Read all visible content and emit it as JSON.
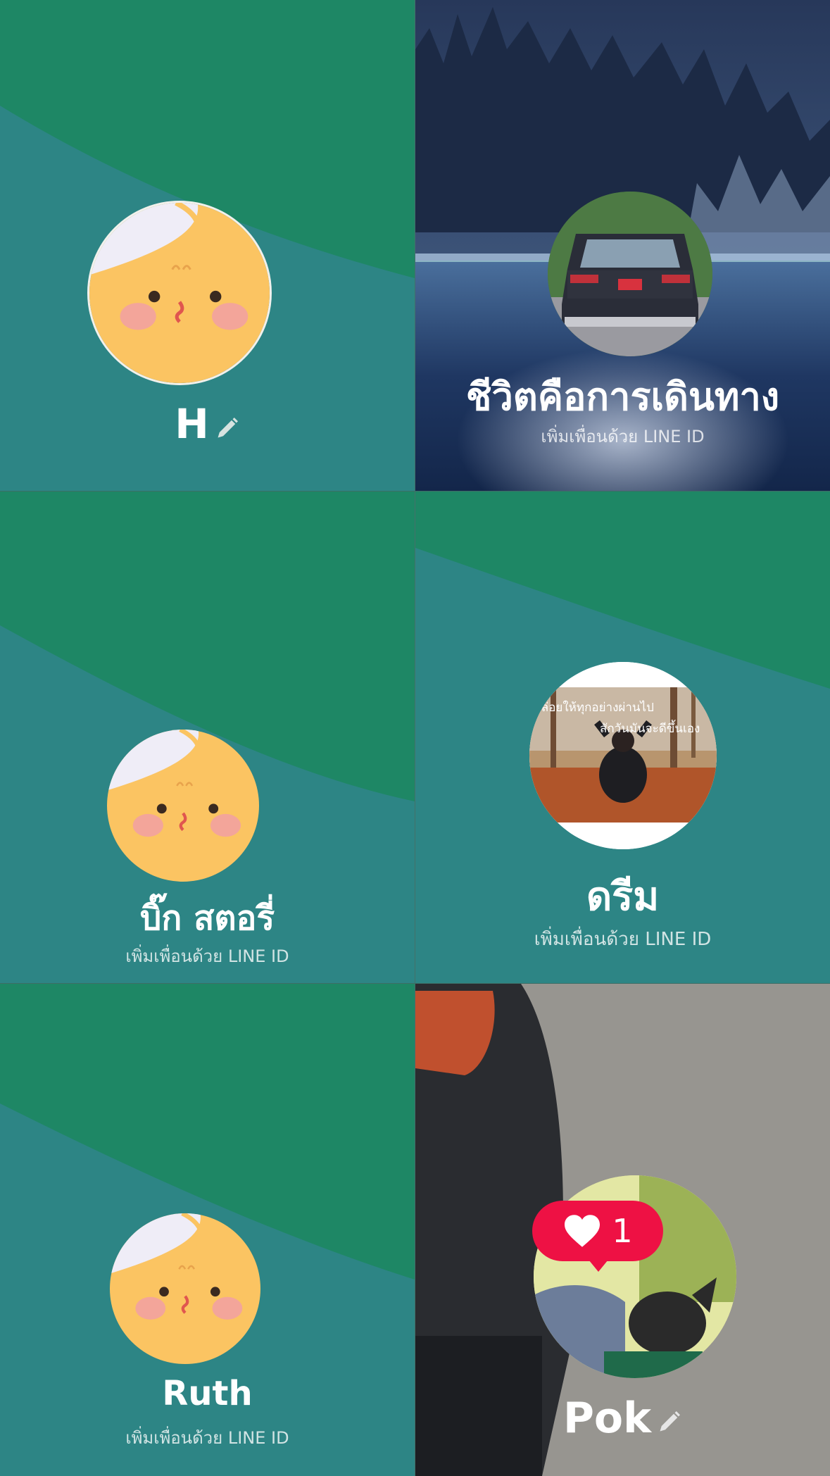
{
  "profiles": [
    {
      "name": "H",
      "subtitle": ""
    },
    {
      "name": "ชีวิตคือการเดินทาง",
      "subtitle": "เพิ่มเพื่อนด้วย LINE ID"
    },
    {
      "name": "บิ๊ก สตอรี่",
      "subtitle": "เพิ่มเพื่อนด้วย LINE ID"
    },
    {
      "name": "ดรีม",
      "subtitle": "เพิ่มเพื่อนด้วย LINE ID",
      "avatar_caption_1": "ปล่อยให้ทุกอย่างผ่านไป",
      "avatar_caption_2": "สักวันมันจะดีขึ้นเอง"
    },
    {
      "name": "Ruth",
      "subtitle": "เพิ่มเพื่อนด้วย LINE ID"
    },
    {
      "name": "Pok",
      "subtitle": ""
    }
  ],
  "like_badge": {
    "count": "1"
  },
  "colors": {
    "green": "#1e8765",
    "teal": "#2d8585",
    "avatar_yellow": "#fbc462",
    "like_red": "#ee1144"
  },
  "icons": [
    "pencil-icon",
    "heart-icon"
  ]
}
